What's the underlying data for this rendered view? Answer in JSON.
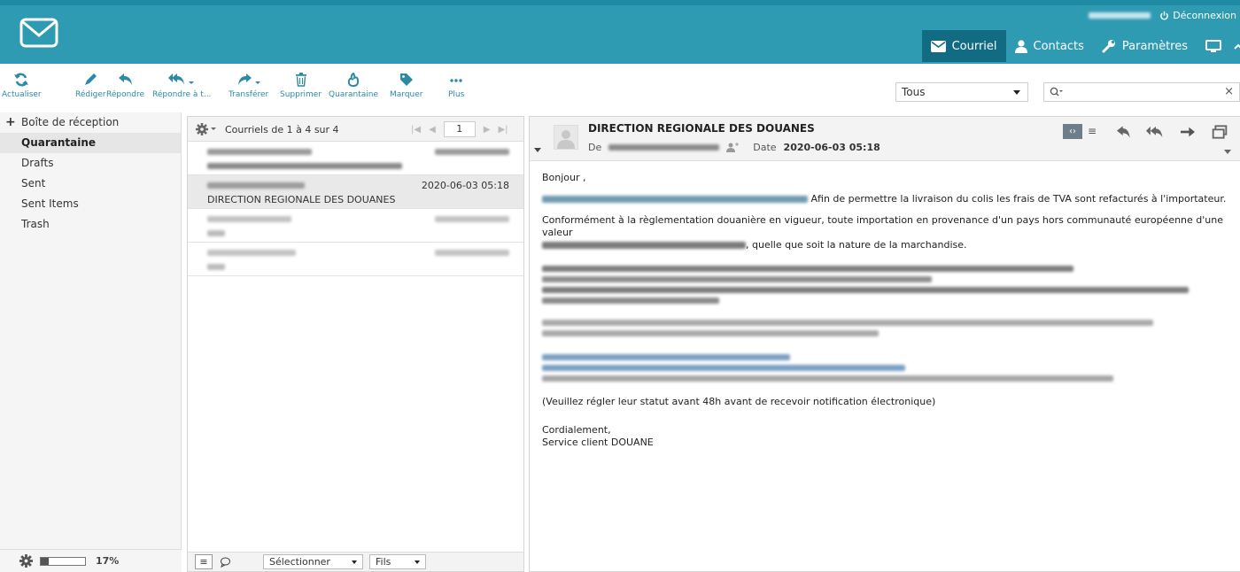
{
  "header": {
    "user_label": "",
    "logout_label": "Déconnexion",
    "nav": [
      {
        "label": "Courriel",
        "icon": "envelope-icon",
        "active": true
      },
      {
        "label": "Contacts",
        "icon": "contact-icon",
        "active": false
      },
      {
        "label": "Paramètres",
        "icon": "wrench-icon",
        "active": false
      },
      {
        "label": "",
        "icon": "monitor-icon",
        "active": false
      }
    ],
    "colors": {
      "bar": "#2e9bb3",
      "active": "#106b83",
      "accent": "#2c8aa5"
    }
  },
  "toolbar": {
    "buttons": [
      {
        "label": "Actualiser",
        "icon": "refresh-icon"
      },
      {
        "label": "Rédiger",
        "icon": "pencil-icon"
      },
      {
        "label": "Répondre",
        "icon": "reply-icon"
      },
      {
        "label": "Répondre à t...",
        "icon": "reply-all-icon"
      },
      {
        "label": "Transférer",
        "icon": "forward-icon"
      },
      {
        "label": "Supprimer",
        "icon": "trash-icon"
      },
      {
        "label": "Quarantaine",
        "icon": "flame-icon"
      },
      {
        "label": "Marquer",
        "icon": "tag-icon"
      },
      {
        "label": "Plus",
        "icon": "more-icon"
      }
    ],
    "filter_value": "Tous",
    "search_value": "",
    "search_clear": "×"
  },
  "folders": {
    "items": [
      {
        "label": "Boîte de réception",
        "active": false
      },
      {
        "label": "Quarantaine",
        "active": true
      },
      {
        "label": "Drafts",
        "active": false
      },
      {
        "label": "Sent",
        "active": false
      },
      {
        "label": "Sent Items",
        "active": false
      },
      {
        "label": "Trash",
        "active": false
      }
    ],
    "quota_text": "17%",
    "quota_fraction": 0.17
  },
  "list": {
    "count_text": "Courriels de 1 à 4 sur 4",
    "page": "1",
    "messages": [
      {
        "from": "",
        "date": "",
        "subject": "",
        "selected": false
      },
      {
        "from": "",
        "date": "2020-06-03 05:18",
        "subject": "DIRECTION REGIONALE DES DOUANES",
        "selected": true
      },
      {
        "from": "",
        "date": "",
        "subject": "",
        "selected": false
      },
      {
        "from": "",
        "date": "",
        "subject": "",
        "selected": false
      }
    ],
    "footer_select": "Sélectionner",
    "footer_threads": "Fils"
  },
  "reader": {
    "subject": "DIRECTION REGIONALE DES DOUANES",
    "from_label": "De",
    "date_label": "Date",
    "date_value": "2020-06-03 05:18",
    "greeting": "Bonjour ,",
    "p1": "Afin de permettre la livraison du colis les frais de TVA sont refacturés à l'importateur.",
    "p2": "Conformément à la règlementation douanière en vigueur, toute importation en provenance d'un pays hors communauté européenne d'une valeur",
    "p2_end": ", quelle que soit la nature de la marchandise.",
    "p3": "(Veuillez régler leur statut avant 48h  avant de recevoir notification électronique)",
    "closing": "Cordialement,",
    "signature": "Service client DOUANE"
  }
}
